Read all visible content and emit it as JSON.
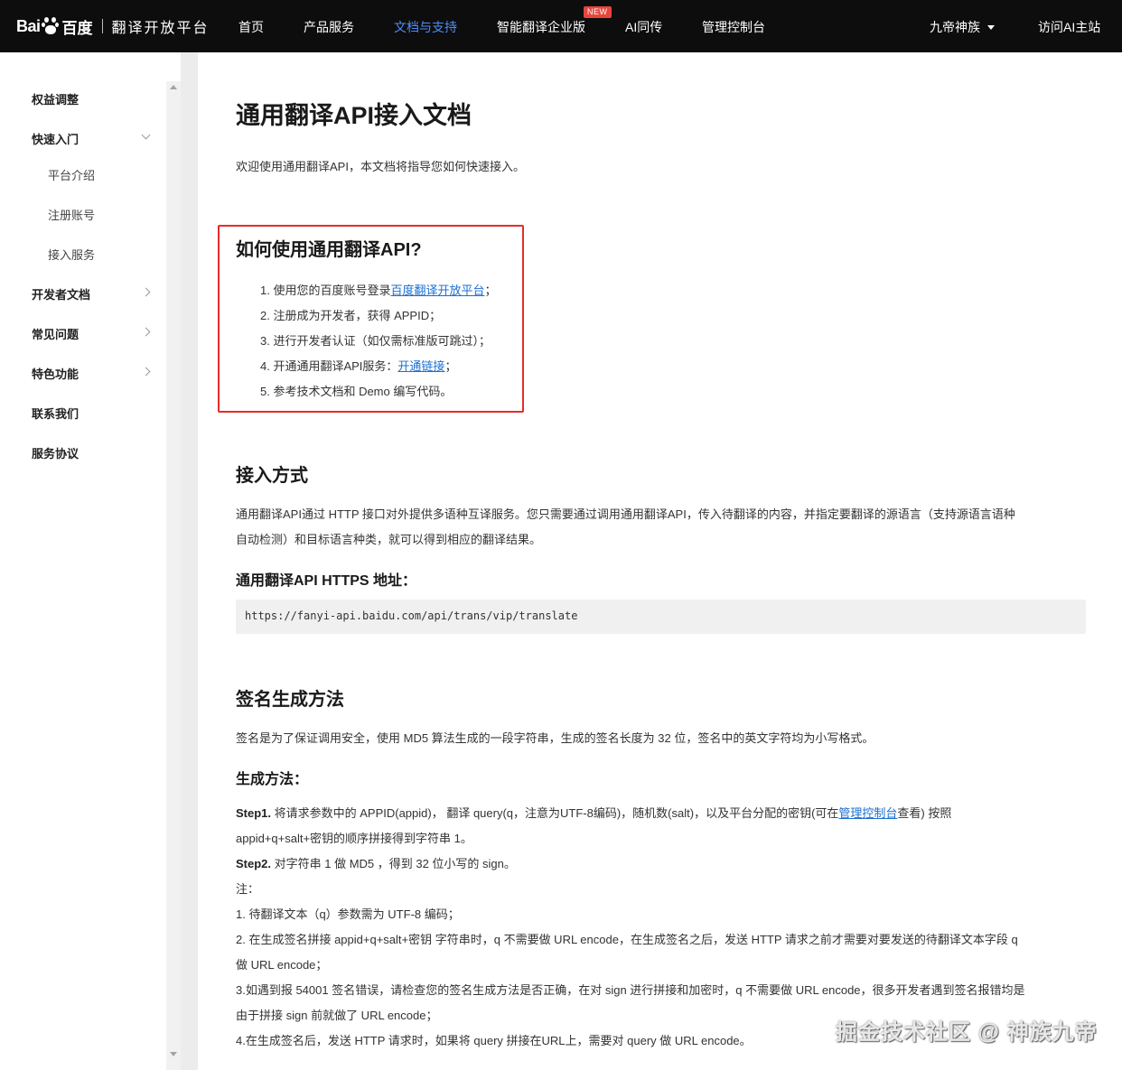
{
  "nav": {
    "logo_text": "Bai",
    "logo_cn": "百度",
    "platform": "翻译开放平台",
    "items": [
      "首页",
      "产品服务",
      "文档与支持",
      "智能翻译企业版",
      "AI同传",
      "管理控制台"
    ],
    "new_badge": "NEW",
    "user": "九帝神族",
    "visit": "访问AI主站"
  },
  "sidebar": {
    "items": [
      {
        "label": "权益调整"
      },
      {
        "label": "快速入门"
      },
      {
        "label": "平台介绍"
      },
      {
        "label": "注册账号"
      },
      {
        "label": "接入服务"
      },
      {
        "label": "开发者文档"
      },
      {
        "label": "常见问题"
      },
      {
        "label": "特色功能"
      },
      {
        "label": "联系我们"
      },
      {
        "label": "服务协议"
      }
    ]
  },
  "main": {
    "title": "通用翻译API接入文档",
    "intro": "欢迎使用通用翻译API，本文档将指导您如何快速接入。",
    "howto": {
      "heading": "如何使用通用翻译API?",
      "step1_prefix": "1. 使用您的百度账号登录",
      "step1_link": "百度翻译开放平台",
      "step1_suffix": "；",
      "step2": "2. 注册成为开发者，获得 APPID；",
      "step3": "3. 进行开发者认证（如仅需标准版可跳过）；",
      "step4_prefix": "4. 开通通用翻译API服务：",
      "step4_link": "开通链接",
      "step4_suffix": "；",
      "step5": "5. 参考技术文档和 Demo 编写代码。"
    },
    "access": {
      "heading": "接入方式",
      "line1": "通用翻译API通过 HTTP 接口对外提供多语种互译服务。您只需要通过调用通用翻译API，传入待翻译的内容，并指定要翻译的源语言（支持源语言语种",
      "line2": "自动检测）和目标语言种类，就可以得到相应的翻译结果。",
      "https_label": "通用翻译API HTTPS 地址：",
      "url": "https://fanyi-api.baidu.com/api/trans/vip/translate"
    },
    "sign": {
      "heading": "签名生成方法",
      "intro": "签名是为了保证调用安全，使用 MD5 算法生成的一段字符串，生成的签名长度为 32 位，签名中的英文字符均为小写格式。",
      "method_label": "生成方法：",
      "step1_bold": "Step1.",
      "step1_text": " 将请求参数中的 APPID(appid)， 翻译 query(q，注意为UTF-8编码)，随机数(salt)，以及平台分配的密钥(可在",
      "step1_link": "管理控制台",
      "step1_after": "查看) 按照",
      "step1_line2": "appid+q+salt+密钥的顺序拼接得到字符串 1。",
      "step2_bold": "Step2.",
      "step2_text": " 对字符串 1 做 MD5 ，得到 32 位小写的 sign。",
      "note": "注：",
      "n1": "1. 待翻译文本（q）参数需为 UTF-8 编码；",
      "n2a": "2. 在生成签名拼接 appid+q+salt+密钥 字符串时，q 不需要做 URL encode，在生成签名之后，发送 HTTP 请求之前才需要对要发送的待翻译文本字段 q",
      "n2b": "做 URL encode；",
      "n3a": "3.如遇到报 54001 签名错误，请检查您的签名生成方法是否正确，在对 sign 进行拼接和加密时，q 不需要做 URL encode，很多开发者遇到签名报错均是",
      "n3b": "由于拼接 sign 前就做了 URL encode；",
      "n4": "4.在生成签名后，发送 HTTP 请求时，如果将 query 拼接在URL上，需要对 query 做 URL encode。"
    }
  },
  "watermark": "掘金技术社区 @ 神族九帝",
  "colors": {
    "nav_bg": "#0d0d0d",
    "active": "#4e8df7",
    "link": "#1c6fd1",
    "highlight_box": "#e62c2c",
    "badge": "#e8453c"
  }
}
